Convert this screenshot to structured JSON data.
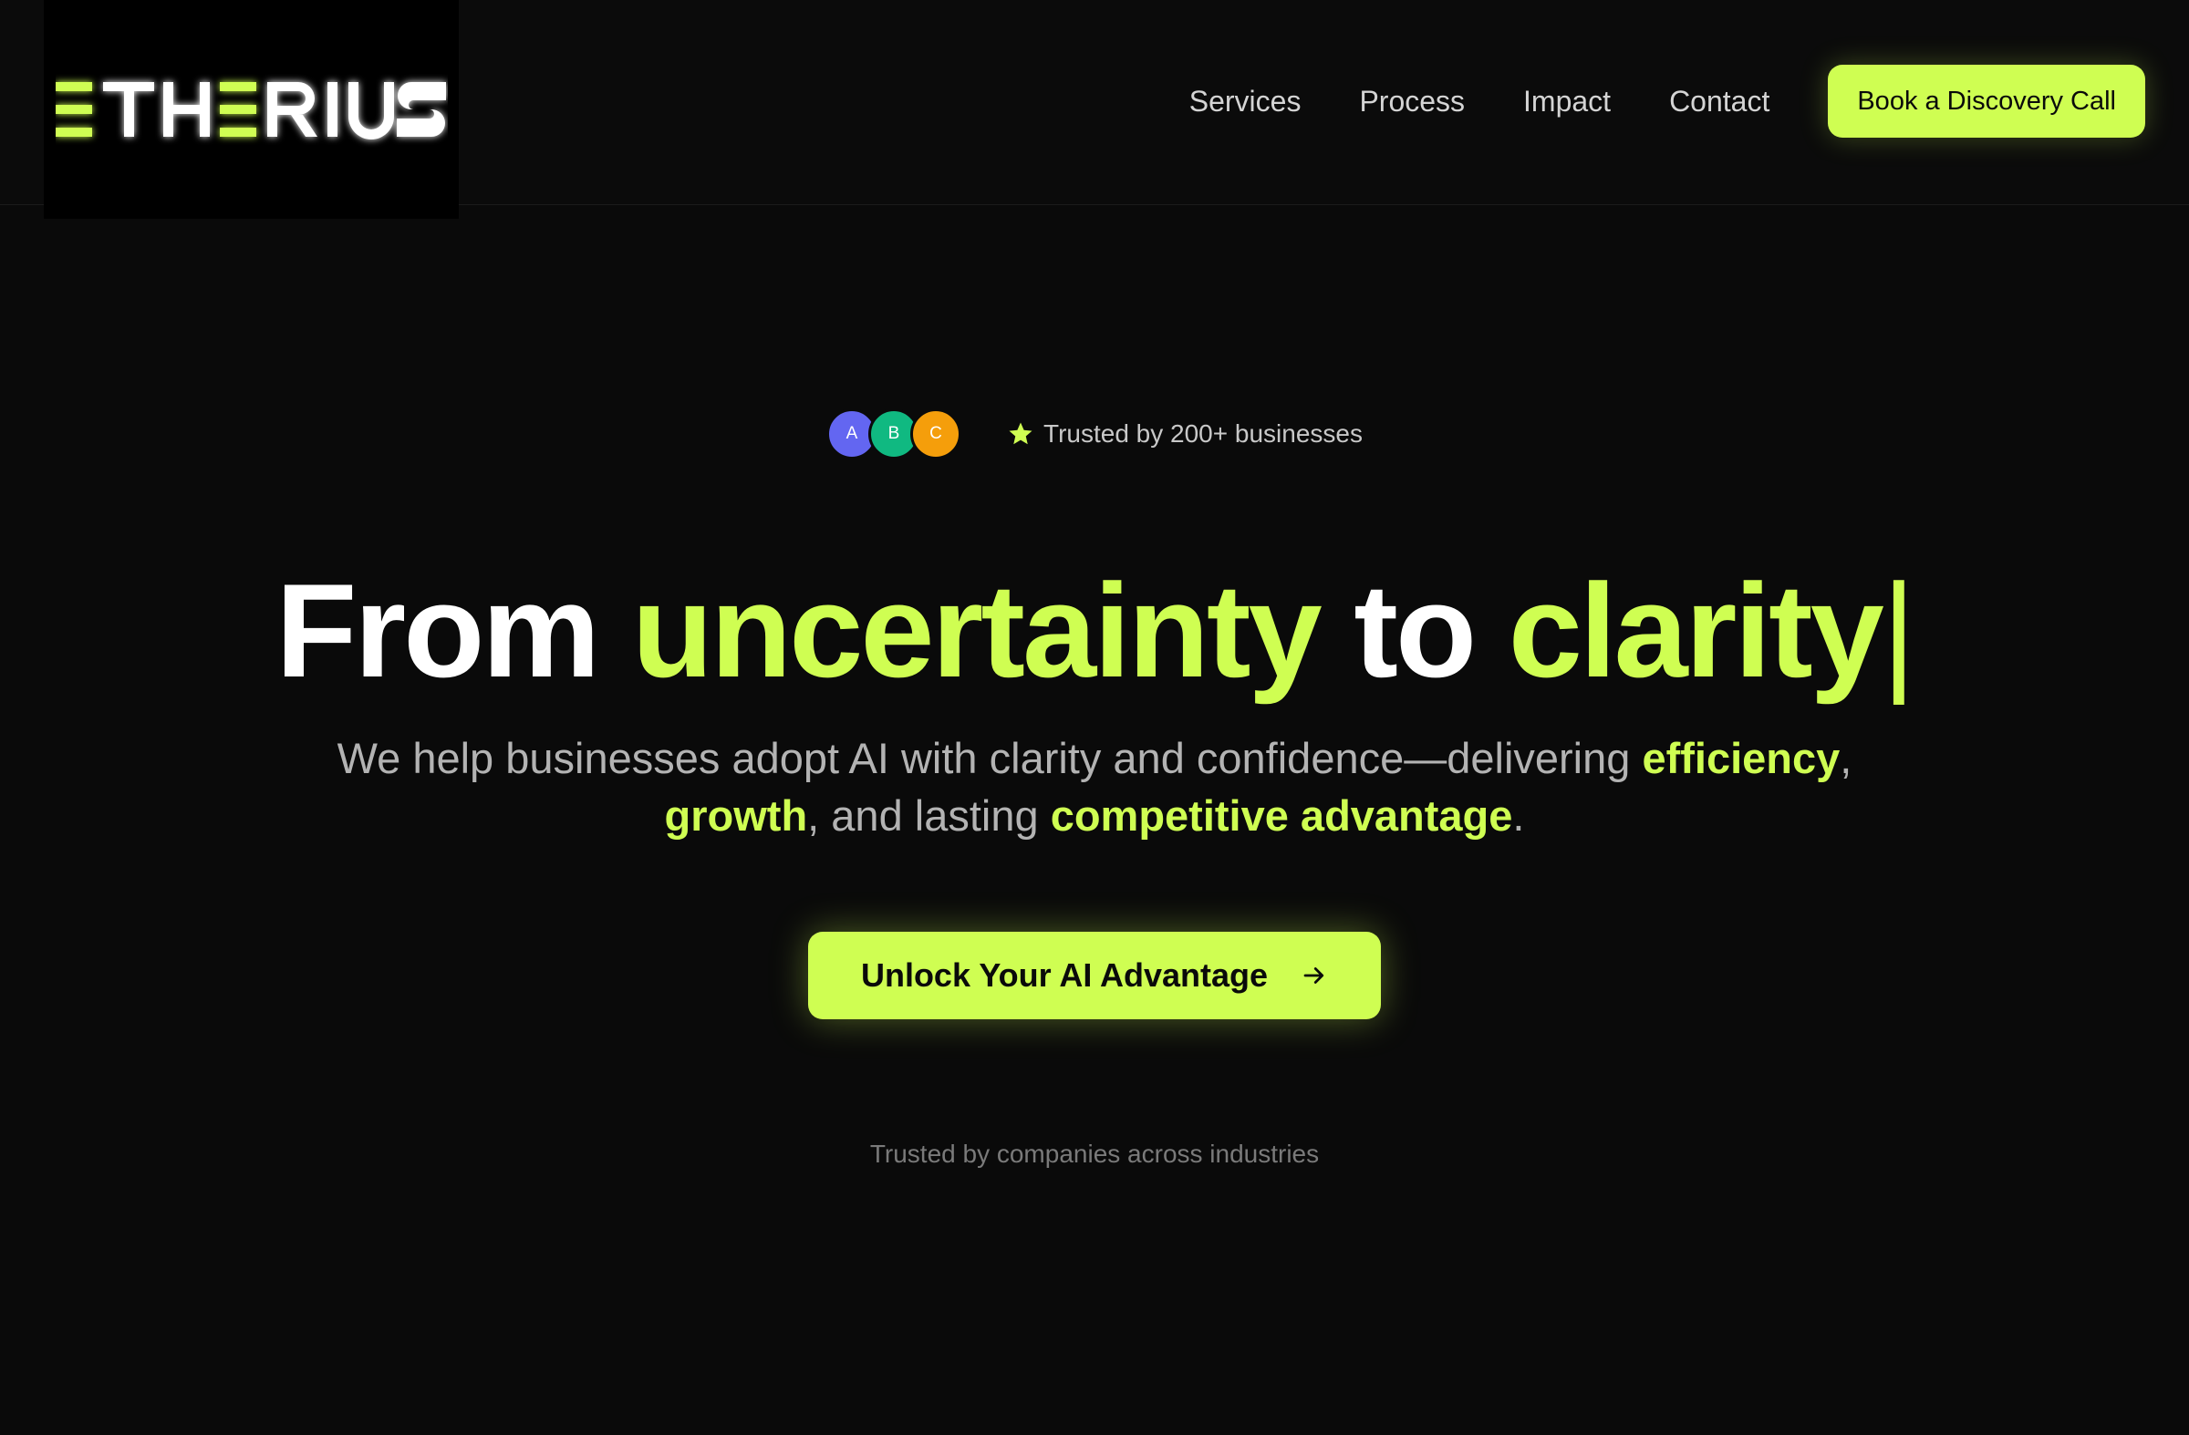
{
  "brand": {
    "logo_text": "ETHERIUS",
    "accent_color": "#cffe52",
    "background_color": "#0a0a0a"
  },
  "nav": {
    "items": [
      {
        "label": "Services"
      },
      {
        "label": "Process"
      },
      {
        "label": "Impact"
      },
      {
        "label": "Contact"
      }
    ],
    "cta_label": "Book a Discovery Call"
  },
  "trust": {
    "avatars": [
      {
        "initial": "A",
        "color": "#6366f1"
      },
      {
        "initial": "B",
        "color": "#10b981"
      },
      {
        "initial": "C",
        "color": "#f59e0b"
      }
    ],
    "icon": "star-icon",
    "text": "Trusted by 200+ businesses"
  },
  "hero": {
    "headline": {
      "part1": "From ",
      "part2": "uncertainty",
      "part3": " to ",
      "part4": "clarity",
      "caret": "|"
    },
    "subhead": {
      "text1": "We help businesses adopt AI with clarity and confidence—delivering ",
      "accent1": "efficiency",
      "text2": ", ",
      "accent2": "growth",
      "text3": ", and lasting ",
      "accent3": "competitive advantage",
      "text4": "."
    },
    "cta_label": "Unlock Your AI Advantage",
    "cta_icon": "arrow-right-icon"
  },
  "companies": {
    "caption": "Trusted by companies across industries"
  }
}
